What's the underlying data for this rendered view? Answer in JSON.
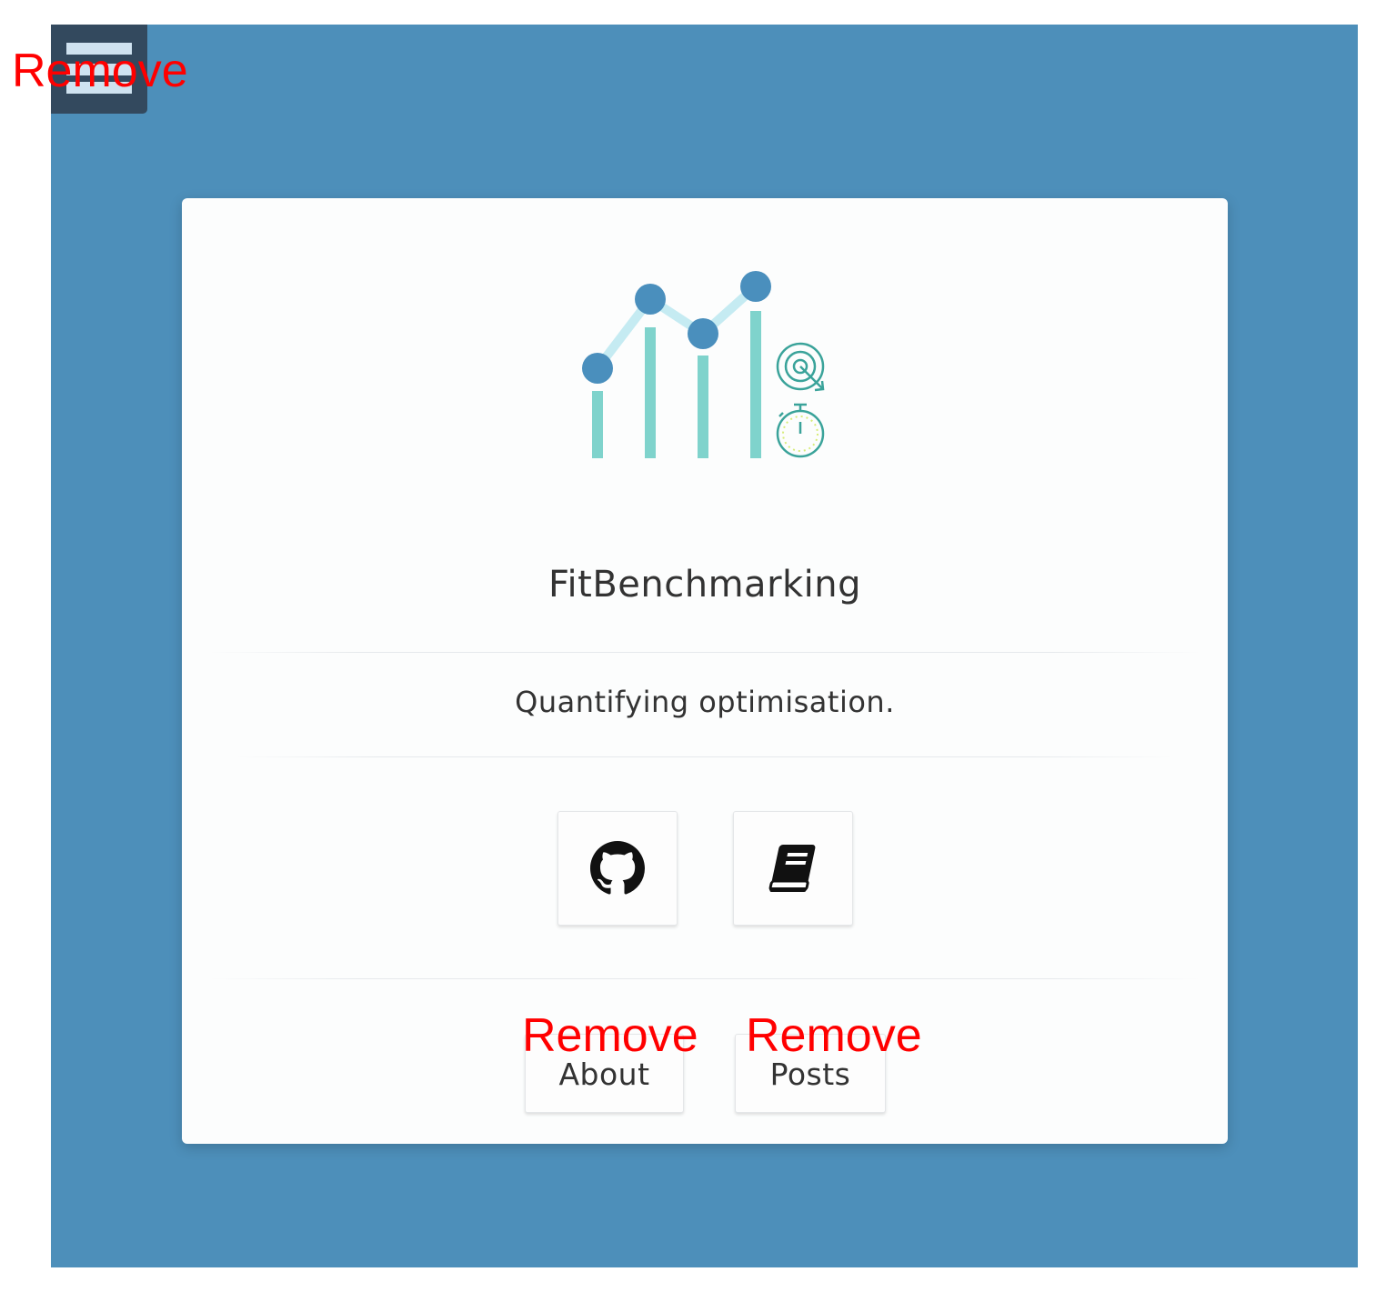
{
  "site": {
    "title": "FitBenchmarking",
    "tagline": "Quantifying optimisation."
  },
  "social_links": [
    {
      "icon": "github-icon",
      "label": ""
    },
    {
      "icon": "book-icon",
      "label": ""
    }
  ],
  "nav": {
    "about_label": "About",
    "posts_label": "Posts"
  },
  "annotations": {
    "menu_remove": "Remove",
    "about_remove": "Remove",
    "posts_remove": "Remove"
  },
  "colors": {
    "background": "#4d8fba",
    "menu_button": "#33495e",
    "card": "#fcfdfd",
    "logo_bars": "#7fd3cc",
    "logo_points": "#4a8fbd",
    "logo_line": "#c5ebf2",
    "annotation": "#ff0000"
  }
}
